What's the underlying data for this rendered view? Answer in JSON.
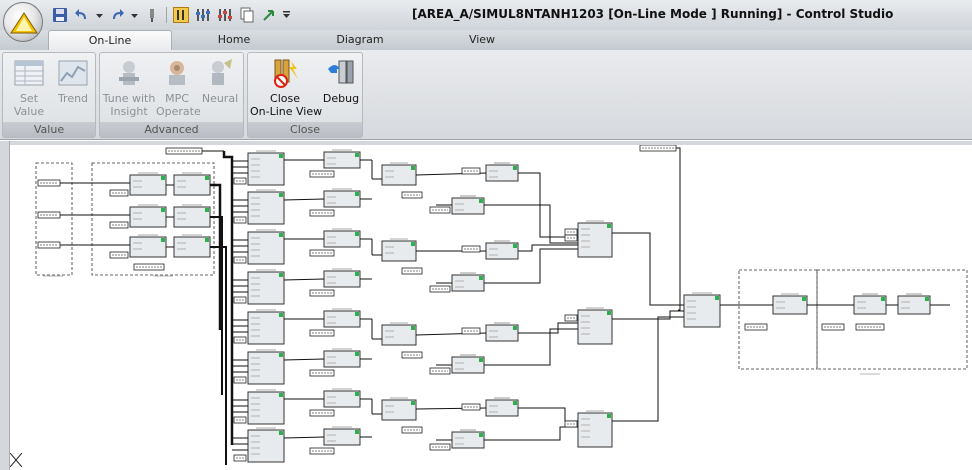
{
  "window": {
    "title": "[AREA_A/SIMUL8NTANH1203 [On-Line Mode ] Running] - Control Studio"
  },
  "logo": {
    "text": "DeltaV"
  },
  "quick_access": [
    "save-icon",
    "undo-icon",
    "dropdown-icon",
    "redo-icon",
    "dropdown-icon",
    "pin-icon",
    "tools-icon",
    "tools-icon",
    "copy-icon",
    "arrow-icon",
    "dropdown-icon"
  ],
  "tabs": [
    {
      "label": "On-Line",
      "active": true
    },
    {
      "label": "Home",
      "active": false
    },
    {
      "label": "Diagram",
      "active": false
    },
    {
      "label": "View",
      "active": false
    }
  ],
  "ribbon": {
    "groups": [
      {
        "label": "Value",
        "buttons": [
          {
            "label": "Set\nValue",
            "icon": "table-icon",
            "enabled": false
          },
          {
            "label": "Trend",
            "icon": "trend-chart-icon",
            "enabled": false
          }
        ]
      },
      {
        "label": "Advanced",
        "buttons": [
          {
            "label": "Tune with\nInsight",
            "icon": "tune-icon",
            "enabled": false
          },
          {
            "label": "MPC\nOperate",
            "icon": "mpc-icon",
            "enabled": false
          },
          {
            "label": "Neural",
            "icon": "neural-icon",
            "enabled": false
          }
        ]
      },
      {
        "label": "Close",
        "buttons": [
          {
            "label": "Close\nOn-Line View",
            "icon": "close-online-icon",
            "enabled": true
          },
          {
            "label": "Debug",
            "icon": "debug-icon",
            "enabled": true
          }
        ]
      }
    ]
  },
  "colors": {
    "block_fill": "#e8ebee",
    "block_border": "#333333",
    "status_green": "#2bb24c",
    "accent_blue": "#1f4f9e"
  }
}
